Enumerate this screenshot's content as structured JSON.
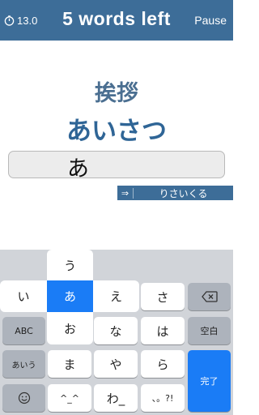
{
  "header": {
    "timer_value": "13.0",
    "title": "5 words left",
    "pause_label": "Pause"
  },
  "quiz": {
    "kanji": "挨拶",
    "reading": "あいさつ",
    "answer": "あ",
    "hint": "りさいくる"
  },
  "keyboard": {
    "flick": {
      "up": "う",
      "left": "い",
      "center": "あ",
      "right": "え",
      "down": "お"
    },
    "row1": {
      "sa": "さ"
    },
    "row2": {
      "abc": "ABC",
      "na": "な",
      "ha": "は",
      "space": "空白"
    },
    "row3": {
      "aiu": "あいう",
      "ma": "ま",
      "ya": "や",
      "ra": "ら",
      "done": "完了"
    },
    "row4": {
      "kaomoji": "^_^",
      "wa": "わ_",
      "punct": "、。?!"
    }
  },
  "colors": {
    "header_bg": "#3d6d98",
    "reading_text": "#2f6596",
    "active_key": "#1a7cf6"
  }
}
